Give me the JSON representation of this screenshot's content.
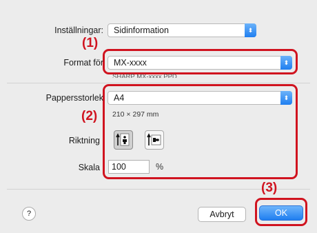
{
  "settings": {
    "label": "Inställningar:",
    "value": "Sidinformation"
  },
  "format": {
    "label": "Format för",
    "value": "MX-xxxx",
    "sublabel": "SHARP MX-xxxx PPD"
  },
  "paper": {
    "label": "Pappersstorlek",
    "value": "A4",
    "dims": "210 × 297 mm"
  },
  "orientation": {
    "label": "Riktning",
    "options": [
      "portrait-orientation-icon",
      "landscape-orientation-icon"
    ],
    "selected": 0
  },
  "scale": {
    "label": "Skala",
    "value": "100",
    "unit": "%"
  },
  "annotations": {
    "a1": "(1)",
    "a2": "(2)",
    "a3": "(3)"
  },
  "buttons": {
    "help": "?",
    "cancel": "Avbryt",
    "ok": "OK"
  },
  "colors": {
    "annotation": "#d0131f",
    "accent": "#1f7ef0"
  }
}
